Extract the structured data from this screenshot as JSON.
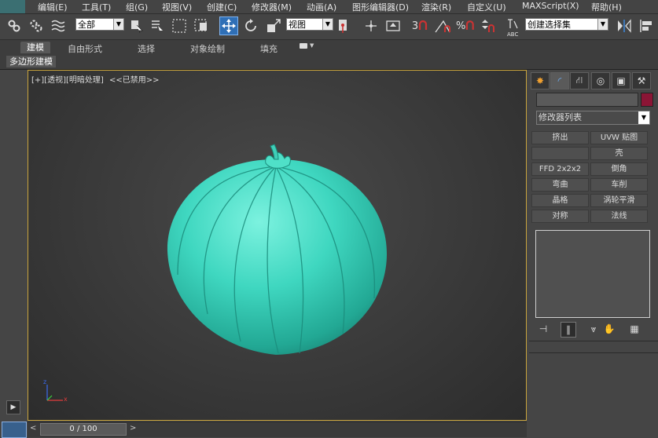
{
  "menubar": {
    "items": [
      "编辑(E)",
      "工具(T)",
      "组(G)",
      "视图(V)",
      "创建(C)",
      "修改器(M)",
      "动画(A)",
      "图形编辑器(D)",
      "渲染(R)",
      "自定义(U)",
      "MAXScript(X)",
      "帮助(H)"
    ]
  },
  "toolbar": {
    "selection_filter": "全部",
    "reference_coord": "视图",
    "named_selection_set": "创建选择集",
    "snap_label": "3",
    "angle_snap_label": "%",
    "text_label": "ABC"
  },
  "ribbon": {
    "tabs": [
      "建模",
      "自由形式",
      "选择",
      "对象绘制",
      "填充"
    ],
    "sub_label": "多边形建模"
  },
  "viewport": {
    "label_plus": "[+]",
    "label_view": "[透视]",
    "label_shading": "[明暗处理]",
    "label_disabled": "<<已禁用>>",
    "axis_z": "z",
    "axis_x": "x"
  },
  "command_panel": {
    "modifier_list": "修改器列表",
    "object_color": "#8b1535",
    "buttons": [
      "挤出",
      "UVW 贴图",
      "",
      "壳",
      "FFD 2x2x2",
      "倒角",
      "弯曲",
      "车削",
      "晶格",
      "涡轮平滑",
      "对称",
      "法线"
    ]
  },
  "timeline": {
    "frame": "0 / 100"
  },
  "colors": {
    "model": "#3ad3bc",
    "viewport_border": "#c9a43c",
    "active_blue": "#2f6fb6"
  }
}
